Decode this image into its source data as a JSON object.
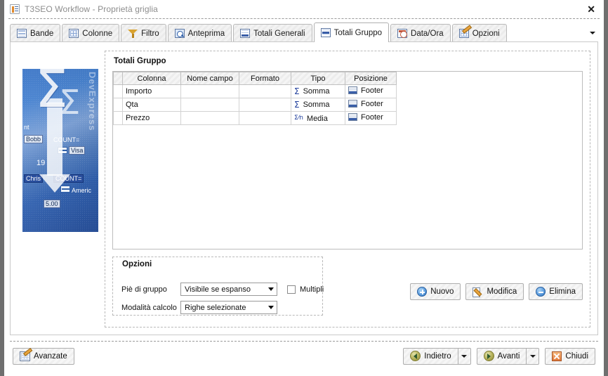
{
  "window": {
    "title": "T3SEO Workflow - Proprietà griglia",
    "app_icon": "grid-properties-icon",
    "close_label": "✕"
  },
  "tabs": [
    {
      "label": "Bande",
      "icon": "bands-icon",
      "active": false
    },
    {
      "label": "Colonne",
      "icon": "columns-grid-icon",
      "active": false
    },
    {
      "label": "Filtro",
      "icon": "funnel-icon",
      "active": false
    },
    {
      "label": "Anteprima",
      "icon": "magnifier-page-icon",
      "active": false
    },
    {
      "label": "Totali Generali",
      "icon": "grand-totals-icon",
      "active": false
    },
    {
      "label": "Totali Gruppo",
      "icon": "group-totals-icon",
      "active": true
    },
    {
      "label": "Data/Ora",
      "icon": "calendar-clock-icon",
      "active": false
    },
    {
      "label": "Opzioni",
      "icon": "grid-pencil-icon",
      "active": false
    }
  ],
  "banner": {
    "sigma_large": "Σ",
    "sigma_small": "Σ",
    "vertical_text": "DevExpress",
    "fragments": {
      "f1": "nt",
      "f2": "Bobb",
      "f3": "COUNT=",
      "f4": "Visa",
      "f5": "19",
      "f6": "Chris",
      "f7": "COUNT=",
      "f8": "Americ",
      "f9": "5.00"
    }
  },
  "panel": {
    "title": "Totali Gruppo"
  },
  "grid": {
    "columns": [
      "Colonna",
      "Nome campo",
      "Formato",
      "Tipo",
      "Posizione"
    ],
    "rows": [
      {
        "colonna": "Importo",
        "nome_campo": "",
        "formato": "",
        "tipo": "Somma",
        "tipo_icon": "sigma-icon",
        "posizione": "Footer",
        "posizione_icon": "footer-band-icon"
      },
      {
        "colonna": "Qta",
        "nome_campo": "",
        "formato": "",
        "tipo": "Somma",
        "tipo_icon": "sigma-icon",
        "posizione": "Footer",
        "posizione_icon": "footer-band-icon"
      },
      {
        "colonna": "Prezzo",
        "nome_campo": "",
        "formato": "",
        "tipo": "Media",
        "tipo_icon": "sigma-over-n-icon",
        "posizione": "Footer",
        "posizione_icon": "footer-band-icon"
      }
    ],
    "type_glyphs": {
      "somma": "Σ",
      "media": "Σ⁄n"
    }
  },
  "options": {
    "title": "Opzioni",
    "pie_di_gruppo": {
      "label": "Piè di gruppo",
      "value": "Visibile se espanso"
    },
    "modalita_calcolo": {
      "label": "Modalità calcolo",
      "value": "Righe selezionate"
    },
    "multipli": {
      "label": "Multipli",
      "checked": false
    }
  },
  "actions": [
    {
      "label": "Nuovo",
      "icon": "plus-circle-icon"
    },
    {
      "label": "Modifica",
      "icon": "pencil-edit-icon"
    },
    {
      "label": "Elimina",
      "icon": "minus-circle-icon"
    }
  ],
  "footer": {
    "advanced": {
      "label": "Avanzate",
      "icon": "grid-pencil-icon"
    },
    "back": {
      "label": "Indietro",
      "icon": "back-arrow-icon"
    },
    "next": {
      "label": "Avanti",
      "icon": "forward-arrow-icon"
    },
    "close": {
      "label": "Chiudi",
      "icon": "close-x-icon"
    }
  },
  "colors": {
    "accent_blue": "#2f6dc4",
    "window_chrome": "#6f6f6f",
    "tab_active_bg": "#ffffff",
    "grid_header": "#ececec",
    "icon_blue": "#1f3e9c",
    "icon_olive": "#b8b45e",
    "icon_orange": "#e0783b"
  }
}
